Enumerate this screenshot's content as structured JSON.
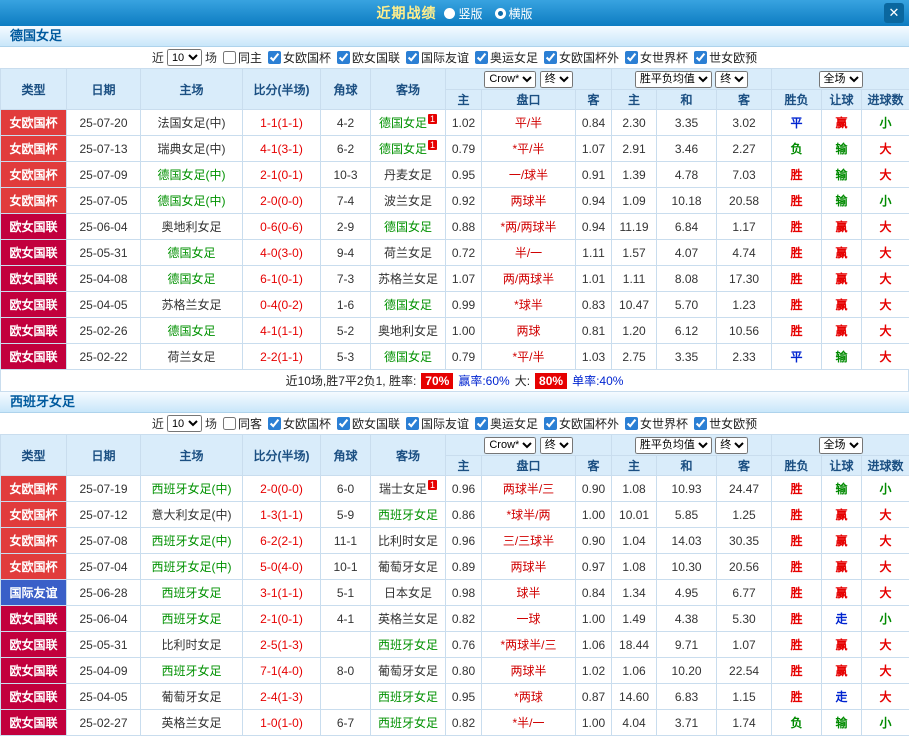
{
  "topbar": {
    "title": "近期战绩",
    "layout_options": [
      {
        "label": "竖版",
        "selected": false
      },
      {
        "label": "横版",
        "selected": true
      }
    ],
    "close_label": "✕"
  },
  "table_headers": {
    "cols": [
      "类型",
      "日期",
      "主场",
      "比分(半场)",
      "角球",
      "客场"
    ],
    "bookmaker": "Crow*",
    "stage": "终",
    "avg": "胜平负均值",
    "stage2": "终",
    "scope": "全场",
    "sub": [
      "主",
      "盘口",
      "客",
      "主",
      "和",
      "客",
      "胜负",
      "让球",
      "进球数"
    ]
  },
  "colors": {
    "type_cup": "#e13c3c",
    "type_league": "#c2003d",
    "type_friendly": "#3a5fc8",
    "focus_team_green": "#009100",
    "score_red": "#e60000",
    "win_red": "#e60000",
    "draw_blue": "#0024d0",
    "lose_green": "#008a00"
  },
  "sections": [
    {
      "title": "德国女足",
      "filter": {
        "prefix": "近",
        "count": "10",
        "suffix": "场",
        "options": [
          {
            "label": "同主",
            "checked": false
          },
          {
            "label": "女欧国杯",
            "checked": true
          },
          {
            "label": "欧女国联",
            "checked": true
          },
          {
            "label": "国际友谊",
            "checked": true
          },
          {
            "label": "奥运女足",
            "checked": true
          },
          {
            "label": "女欧国杯外",
            "checked": true
          },
          {
            "label": "女世界杯",
            "checked": true
          },
          {
            "label": "世女欧预",
            "checked": true
          }
        ]
      },
      "rows": [
        {
          "type": "女欧国杯",
          "type_class": "cup",
          "date": "25-07-20",
          "home": {
            "name": "法国女足(中)",
            "focus": false,
            "badge": ""
          },
          "score": "1-1(1-1)",
          "corners": "4-2",
          "away": {
            "name": "德国女足",
            "focus": true,
            "badge": "1"
          },
          "odds": {
            "home": "1.02",
            "handicap": "平/半",
            "away": "0.84"
          },
          "europe": {
            "win": "2.30",
            "draw": "3.35",
            "lose": "3.02"
          },
          "result": "平",
          "handicap_result": "赢",
          "goals_result": "小"
        },
        {
          "type": "女欧国杯",
          "type_class": "cup",
          "date": "25-07-13",
          "home": {
            "name": "瑞典女足(中)",
            "focus": false,
            "badge": ""
          },
          "score": "4-1(3-1)",
          "corners": "6-2",
          "away": {
            "name": "德国女足",
            "focus": true,
            "badge": "1"
          },
          "odds": {
            "home": "0.79",
            "handicap": "*平/半",
            "away": "1.07"
          },
          "europe": {
            "win": "2.91",
            "draw": "3.46",
            "lose": "2.27"
          },
          "result": "负",
          "handicap_result": "输",
          "goals_result": "大"
        },
        {
          "type": "女欧国杯",
          "type_class": "cup",
          "date": "25-07-09",
          "home": {
            "name": "德国女足(中)",
            "focus": true,
            "badge": ""
          },
          "score": "2-1(0-1)",
          "corners": "10-3",
          "away": {
            "name": "丹麦女足",
            "focus": false,
            "badge": ""
          },
          "odds": {
            "home": "0.95",
            "handicap": "一/球半",
            "away": "0.91"
          },
          "europe": {
            "win": "1.39",
            "draw": "4.78",
            "lose": "7.03"
          },
          "result": "胜",
          "handicap_result": "输",
          "goals_result": "大"
        },
        {
          "type": "女欧国杯",
          "type_class": "cup",
          "date": "25-07-05",
          "home": {
            "name": "德国女足(中)",
            "focus": true,
            "badge": ""
          },
          "score": "2-0(0-0)",
          "corners": "7-4",
          "away": {
            "name": "波兰女足",
            "focus": false,
            "badge": ""
          },
          "odds": {
            "home": "0.92",
            "handicap": "两球半",
            "away": "0.94"
          },
          "europe": {
            "win": "1.09",
            "draw": "10.18",
            "lose": "20.58"
          },
          "result": "胜",
          "handicap_result": "输",
          "goals_result": "小"
        },
        {
          "type": "欧女国联",
          "type_class": "league",
          "date": "25-06-04",
          "home": {
            "name": "奥地利女足",
            "focus": false,
            "badge": ""
          },
          "score": "0-6(0-6)",
          "corners": "2-9",
          "away": {
            "name": "德国女足",
            "focus": true,
            "badge": ""
          },
          "odds": {
            "home": "0.88",
            "handicap": "*两/两球半",
            "away": "0.94"
          },
          "europe": {
            "win": "11.19",
            "draw": "6.84",
            "lose": "1.17"
          },
          "result": "胜",
          "handicap_result": "赢",
          "goals_result": "大"
        },
        {
          "type": "欧女国联",
          "type_class": "league",
          "date": "25-05-31",
          "home": {
            "name": "德国女足",
            "focus": true,
            "badge": ""
          },
          "score": "4-0(3-0)",
          "corners": "9-4",
          "away": {
            "name": "荷兰女足",
            "focus": false,
            "badge": ""
          },
          "odds": {
            "home": "0.72",
            "handicap": "半/一",
            "away": "1.11"
          },
          "europe": {
            "win": "1.57",
            "draw": "4.07",
            "lose": "4.74"
          },
          "result": "胜",
          "handicap_result": "赢",
          "goals_result": "大"
        },
        {
          "type": "欧女国联",
          "type_class": "league",
          "date": "25-04-08",
          "home": {
            "name": "德国女足",
            "focus": true,
            "badge": ""
          },
          "score": "6-1(0-1)",
          "corners": "7-3",
          "away": {
            "name": "苏格兰女足",
            "focus": false,
            "badge": ""
          },
          "odds": {
            "home": "1.07",
            "handicap": "两/两球半",
            "away": "1.01"
          },
          "europe": {
            "win": "1.11",
            "draw": "8.08",
            "lose": "17.30"
          },
          "result": "胜",
          "handicap_result": "赢",
          "goals_result": "大"
        },
        {
          "type": "欧女国联",
          "type_class": "league",
          "date": "25-04-05",
          "home": {
            "name": "苏格兰女足",
            "focus": false,
            "badge": ""
          },
          "score": "0-4(0-2)",
          "corners": "1-6",
          "away": {
            "name": "德国女足",
            "focus": true,
            "badge": ""
          },
          "odds": {
            "home": "0.99",
            "handicap": "*球半",
            "away": "0.83"
          },
          "europe": {
            "win": "10.47",
            "draw": "5.70",
            "lose": "1.23"
          },
          "result": "胜",
          "handicap_result": "赢",
          "goals_result": "大"
        },
        {
          "type": "欧女国联",
          "type_class": "league",
          "date": "25-02-26",
          "home": {
            "name": "德国女足",
            "focus": true,
            "badge": ""
          },
          "score": "4-1(1-1)",
          "corners": "5-2",
          "away": {
            "name": "奥地利女足",
            "focus": false,
            "badge": ""
          },
          "odds": {
            "home": "1.00",
            "handicap": "两球",
            "away": "0.81"
          },
          "europe": {
            "win": "1.20",
            "draw": "6.12",
            "lose": "10.56"
          },
          "result": "胜",
          "handicap_result": "赢",
          "goals_result": "大"
        },
        {
          "type": "欧女国联",
          "type_class": "league",
          "date": "25-02-22",
          "home": {
            "name": "荷兰女足",
            "focus": false,
            "badge": ""
          },
          "score": "2-2(1-1)",
          "corners": "5-3",
          "away": {
            "name": "德国女足",
            "focus": true,
            "badge": ""
          },
          "odds": {
            "home": "0.79",
            "handicap": "*平/半",
            "away": "1.03"
          },
          "europe": {
            "win": "2.75",
            "draw": "3.35",
            "lose": "2.33"
          },
          "result": "平",
          "handicap_result": "输",
          "goals_result": "大"
        }
      ],
      "stats": {
        "summary": "近10场,胜7平2负1, 胜率:",
        "win_rate": "70%",
        "handicap_rate": "赢率:60%",
        "big_label": "大:",
        "big_rate": "80%",
        "single_rate": "单率:40%"
      }
    },
    {
      "title": "西班牙女足",
      "filter": {
        "prefix": "近",
        "count": "10",
        "suffix": "场",
        "options": [
          {
            "label": "同客",
            "checked": false
          },
          {
            "label": "女欧国杯",
            "checked": true
          },
          {
            "label": "欧女国联",
            "checked": true
          },
          {
            "label": "国际友谊",
            "checked": true
          },
          {
            "label": "奥运女足",
            "checked": true
          },
          {
            "label": "女欧国杯外",
            "checked": true
          },
          {
            "label": "女世界杯",
            "checked": true
          },
          {
            "label": "世女欧预",
            "checked": true
          }
        ]
      },
      "rows": [
        {
          "type": "女欧国杯",
          "type_class": "cup",
          "date": "25-07-19",
          "home": {
            "name": "西班牙女足(中)",
            "focus": true,
            "badge": ""
          },
          "score": "2-0(0-0)",
          "corners": "6-0",
          "away": {
            "name": "瑞士女足",
            "focus": false,
            "badge": "1"
          },
          "odds": {
            "home": "0.96",
            "handicap": "两球半/三",
            "away": "0.90"
          },
          "europe": {
            "win": "1.08",
            "draw": "10.93",
            "lose": "24.47"
          },
          "result": "胜",
          "handicap_result": "输",
          "goals_result": "小"
        },
        {
          "type": "女欧国杯",
          "type_class": "cup",
          "date": "25-07-12",
          "home": {
            "name": "意大利女足(中)",
            "focus": false,
            "badge": ""
          },
          "score": "1-3(1-1)",
          "corners": "5-9",
          "away": {
            "name": "西班牙女足",
            "focus": true,
            "badge": ""
          },
          "odds": {
            "home": "0.86",
            "handicap": "*球半/两",
            "away": "1.00"
          },
          "europe": {
            "win": "10.01",
            "draw": "5.85",
            "lose": "1.25"
          },
          "result": "胜",
          "handicap_result": "赢",
          "goals_result": "大"
        },
        {
          "type": "女欧国杯",
          "type_class": "cup",
          "date": "25-07-08",
          "home": {
            "name": "西班牙女足(中)",
            "focus": true,
            "badge": ""
          },
          "score": "6-2(2-1)",
          "corners": "11-1",
          "away": {
            "name": "比利时女足",
            "focus": false,
            "badge": ""
          },
          "odds": {
            "home": "0.96",
            "handicap": "三/三球半",
            "away": "0.90"
          },
          "europe": {
            "win": "1.04",
            "draw": "14.03",
            "lose": "30.35"
          },
          "result": "胜",
          "handicap_result": "赢",
          "goals_result": "大"
        },
        {
          "type": "女欧国杯",
          "type_class": "cup",
          "date": "25-07-04",
          "home": {
            "name": "西班牙女足(中)",
            "focus": true,
            "badge": ""
          },
          "score": "5-0(4-0)",
          "corners": "10-1",
          "away": {
            "name": "葡萄牙女足",
            "focus": false,
            "badge": ""
          },
          "odds": {
            "home": "0.89",
            "handicap": "两球半",
            "away": "0.97"
          },
          "europe": {
            "win": "1.08",
            "draw": "10.30",
            "lose": "20.56"
          },
          "result": "胜",
          "handicap_result": "赢",
          "goals_result": "大"
        },
        {
          "type": "国际友谊",
          "type_class": "friendly",
          "date": "25-06-28",
          "home": {
            "name": "西班牙女足",
            "focus": true,
            "badge": ""
          },
          "score": "3-1(1-1)",
          "corners": "5-1",
          "away": {
            "name": "日本女足",
            "focus": false,
            "badge": ""
          },
          "odds": {
            "home": "0.98",
            "handicap": "球半",
            "away": "0.84"
          },
          "europe": {
            "win": "1.34",
            "draw": "4.95",
            "lose": "6.77"
          },
          "result": "胜",
          "handicap_result": "赢",
          "goals_result": "大"
        },
        {
          "type": "欧女国联",
          "type_class": "league",
          "date": "25-06-04",
          "home": {
            "name": "西班牙女足",
            "focus": true,
            "badge": ""
          },
          "score": "2-1(0-1)",
          "corners": "4-1",
          "away": {
            "name": "英格兰女足",
            "focus": false,
            "badge": ""
          },
          "odds": {
            "home": "0.82",
            "handicap": "一球",
            "away": "1.00"
          },
          "europe": {
            "win": "1.49",
            "draw": "4.38",
            "lose": "5.30"
          },
          "result": "胜",
          "handicap_result": "走",
          "goals_result": "小"
        },
        {
          "type": "欧女国联",
          "type_class": "league",
          "date": "25-05-31",
          "home": {
            "name": "比利时女足",
            "focus": false,
            "badge": ""
          },
          "score": "2-5(1-3)",
          "corners": "",
          "away": {
            "name": "西班牙女足",
            "focus": true,
            "badge": ""
          },
          "odds": {
            "home": "0.76",
            "handicap": "*两球半/三",
            "away": "1.06"
          },
          "europe": {
            "win": "18.44",
            "draw": "9.71",
            "lose": "1.07"
          },
          "result": "胜",
          "handicap_result": "赢",
          "goals_result": "大"
        },
        {
          "type": "欧女国联",
          "type_class": "league",
          "date": "25-04-09",
          "home": {
            "name": "西班牙女足",
            "focus": true,
            "badge": ""
          },
          "score": "7-1(4-0)",
          "corners": "8-0",
          "away": {
            "name": "葡萄牙女足",
            "focus": false,
            "badge": ""
          },
          "odds": {
            "home": "0.80",
            "handicap": "两球半",
            "away": "1.02"
          },
          "europe": {
            "win": "1.06",
            "draw": "10.20",
            "lose": "22.54"
          },
          "result": "胜",
          "handicap_result": "赢",
          "goals_result": "大"
        },
        {
          "type": "欧女国联",
          "type_class": "league",
          "date": "25-04-05",
          "home": {
            "name": "葡萄牙女足",
            "focus": false,
            "badge": ""
          },
          "score": "2-4(1-3)",
          "corners": "",
          "away": {
            "name": "西班牙女足",
            "focus": true,
            "badge": ""
          },
          "odds": {
            "home": "0.95",
            "handicap": "*两球",
            "away": "0.87"
          },
          "europe": {
            "win": "14.60",
            "draw": "6.83",
            "lose": "1.15"
          },
          "result": "胜",
          "handicap_result": "走",
          "goals_result": "大"
        },
        {
          "type": "欧女国联",
          "type_class": "league",
          "date": "25-02-27",
          "home": {
            "name": "英格兰女足",
            "focus": false,
            "badge": ""
          },
          "score": "1-0(1-0)",
          "corners": "6-7",
          "away": {
            "name": "西班牙女足",
            "focus": true,
            "badge": ""
          },
          "odds": {
            "home": "0.82",
            "handicap": "*半/一",
            "away": "1.00"
          },
          "europe": {
            "win": "4.04",
            "draw": "3.71",
            "lose": "1.74"
          },
          "result": "负",
          "handicap_result": "输",
          "goals_result": "小"
        }
      ]
    }
  ]
}
